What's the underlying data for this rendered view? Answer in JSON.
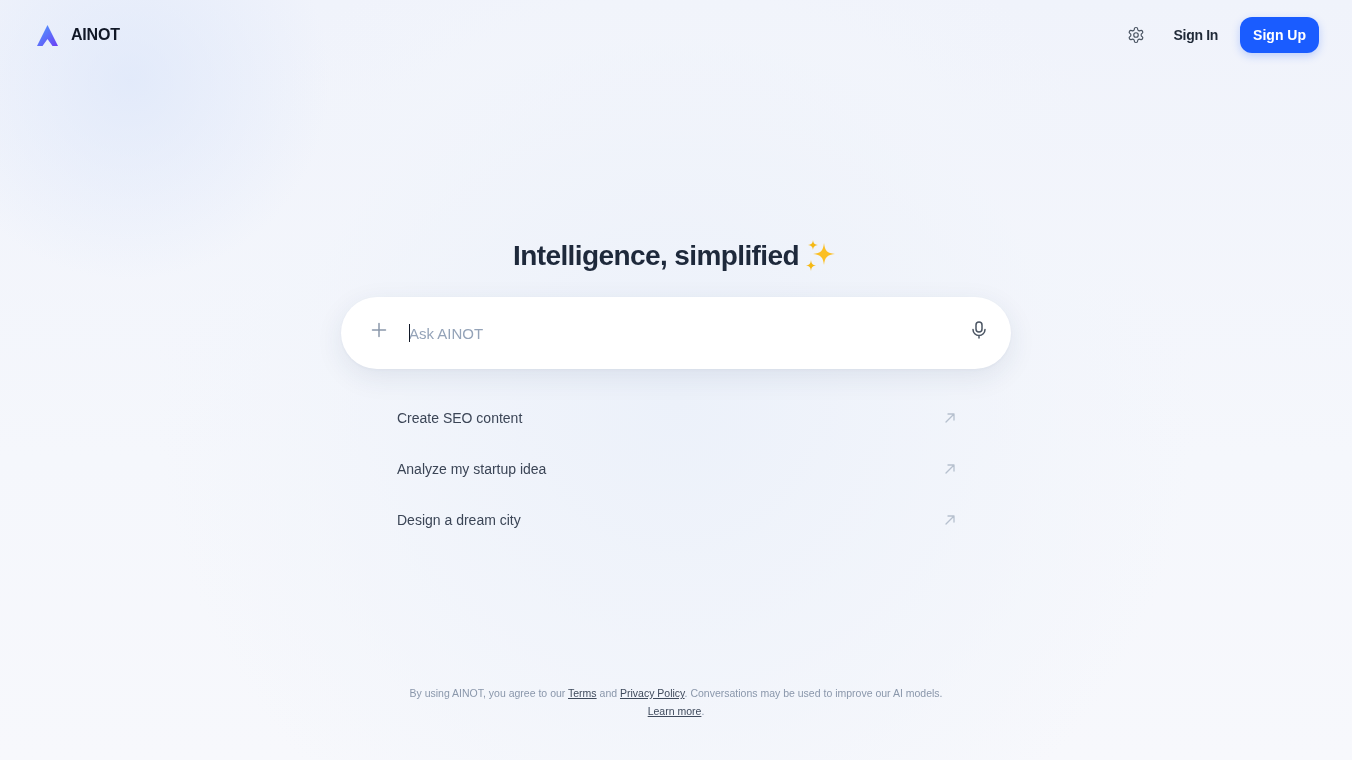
{
  "header": {
    "brand": "AINOT",
    "actions": [
      {
        "kind": "icon"
      },
      {
        "kind": "link",
        "label": "Sign In"
      },
      {
        "kind": "primary",
        "label": "Sign Up"
      }
    ]
  },
  "hero": {
    "title": "Intelligence, simplified"
  },
  "search": {
    "placeholder": "Ask AINOT",
    "focused": true
  },
  "suggestions": [
    {
      "label": "Create SEO content"
    },
    {
      "label": "Analyze my startup idea"
    },
    {
      "label": "Design a dream city"
    }
  ],
  "footer": {
    "lines": [
      [
        {
          "kind": "text",
          "text": "By using AINOT, you agree to our "
        },
        {
          "kind": "link",
          "text": "Terms"
        },
        {
          "kind": "text",
          "text": " and "
        },
        {
          "kind": "link",
          "text": "Privacy Policy"
        },
        {
          "kind": "text",
          "text": ". Conversations may be used to improve our AI models."
        }
      ],
      [
        {
          "kind": "link",
          "text": "Learn more"
        },
        {
          "kind": "text",
          "text": "."
        }
      ]
    ]
  }
}
